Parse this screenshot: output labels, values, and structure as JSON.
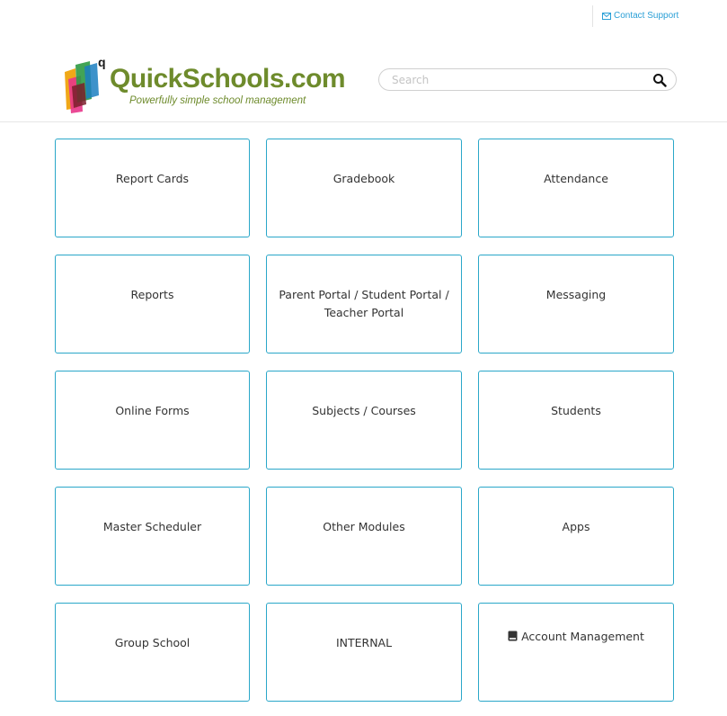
{
  "topbar": {
    "contact_label": "Contact Support",
    "contact_icon": "mail-icon"
  },
  "brand": {
    "name": "QuickSchools.com",
    "superscript": "q",
    "tagline": "Powerfully simple school management",
    "color": "#6e8b2c"
  },
  "search": {
    "placeholder": "Search",
    "value": "",
    "icon": "search-icon"
  },
  "accent_color": "#2aa7c9",
  "tiles": [
    {
      "label": "Report Cards"
    },
    {
      "label": "Gradebook"
    },
    {
      "label": "Attendance"
    },
    {
      "label": "Reports"
    },
    {
      "label": "Parent Portal / Student Portal / Teacher Portal"
    },
    {
      "label": "Messaging"
    },
    {
      "label": "Online Forms"
    },
    {
      "label": "Subjects / Courses"
    },
    {
      "label": "Students"
    },
    {
      "label": "Master Scheduler"
    },
    {
      "label": "Other Modules"
    },
    {
      "label": "Apps"
    },
    {
      "label": "Group School"
    },
    {
      "label": "INTERNAL"
    },
    {
      "label": "Account Management",
      "icon": "book-icon"
    }
  ]
}
